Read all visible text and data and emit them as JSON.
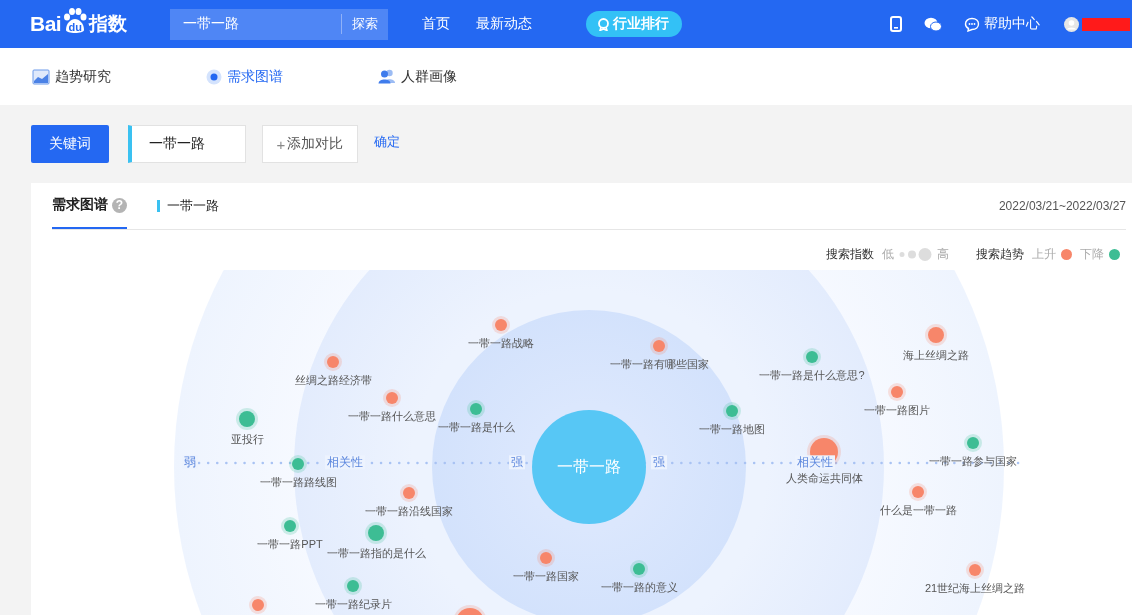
{
  "header": {
    "logo": {
      "left": "Bai",
      "paw": "du",
      "right": "指数"
    },
    "search": {
      "value": "一带一路",
      "button": "探索"
    },
    "nav": [
      {
        "label": "首页",
        "kind": "link"
      },
      {
        "label": "最新动态",
        "kind": "link"
      },
      {
        "label": "行业排行",
        "kind": "pill"
      }
    ],
    "help": "帮助中心"
  },
  "subnav": [
    {
      "label": "趋势研究",
      "kind": "trend",
      "selected": false
    },
    {
      "label": "需求图谱",
      "kind": "map",
      "selected": true
    },
    {
      "label": "人群画像",
      "kind": "people",
      "selected": false
    }
  ],
  "query": {
    "button": "关键词",
    "keyword": "一带一路",
    "add_icon": "+",
    "add": "添加对比",
    "confirm": "确定"
  },
  "card": {
    "tabs": [
      {
        "label": "需求图谱",
        "help": "?",
        "selected": true
      }
    ],
    "keyword": "一带一路",
    "date": "2022/03/21~2022/03/27",
    "legend": {
      "index_label": "搜索指数",
      "low": "低",
      "high": "高",
      "trend_label": "搜索趋势",
      "up": "上升",
      "down": "下降"
    },
    "graph": {
      "center": "一带一路",
      "axis": [
        "弱",
        "相关性",
        "强",
        "强",
        "相关性"
      ],
      "nodes": [
        {
          "label": "一带一路战略",
          "color": "#f7866a",
          "kind": "small"
        },
        {
          "label": "海上丝绸之路",
          "color": "#f7866a",
          "kind": "medium"
        },
        {
          "label": "一带一路有哪些国家",
          "color": "#f7866a",
          "kind": "small"
        },
        {
          "label": "一带一路是什么意思?",
          "color": "#3dbd94",
          "kind": "small"
        },
        {
          "label": "丝绸之路经济带",
          "color": "#f7866a",
          "kind": "small"
        },
        {
          "label": "一带一路图片",
          "color": "#f7866a",
          "kind": "small"
        },
        {
          "label": "一带一路什么意思",
          "color": "#f7866a",
          "kind": "small"
        },
        {
          "label": "一带一路是什么",
          "color": "#3dbd94",
          "kind": "small"
        },
        {
          "label": "一带一路地图",
          "color": "#3dbd94",
          "kind": "small"
        },
        {
          "label": "亚投行",
          "color": "#3dbd94",
          "kind": "medium"
        },
        {
          "label": "一带一路路线图",
          "color": "#3dbd94",
          "kind": "small"
        },
        {
          "label": "人类命运共同体",
          "color": "#f7866a",
          "kind": "large"
        },
        {
          "label": "一带一路参与国家",
          "color": "#3dbd94",
          "kind": "small"
        },
        {
          "label": "一带一路沿线国家",
          "color": "#f7866a",
          "kind": "small"
        },
        {
          "label": "什么是一带一路",
          "color": "#f7866a",
          "kind": "small"
        },
        {
          "label": "一带一路PPT",
          "color": "#3dbd94",
          "kind": "small"
        },
        {
          "label": "一带一路指的是什么",
          "color": "#3dbd94",
          "kind": "medium"
        },
        {
          "label": "一带一路国家",
          "color": "#f7866a",
          "kind": "small"
        },
        {
          "label": "一带一路的意义",
          "color": "#3dbd94",
          "kind": "small"
        },
        {
          "label": "21世纪海上丝绸之路",
          "color": "#f7866a",
          "kind": "small"
        },
        {
          "label": "一带一路纪录片",
          "color": "#3dbd94",
          "kind": "small"
        },
        {
          "color": "#f7866a",
          "kind": "small"
        },
        {
          "color": "#f7866a",
          "kind": "large"
        }
      ]
    }
  }
}
